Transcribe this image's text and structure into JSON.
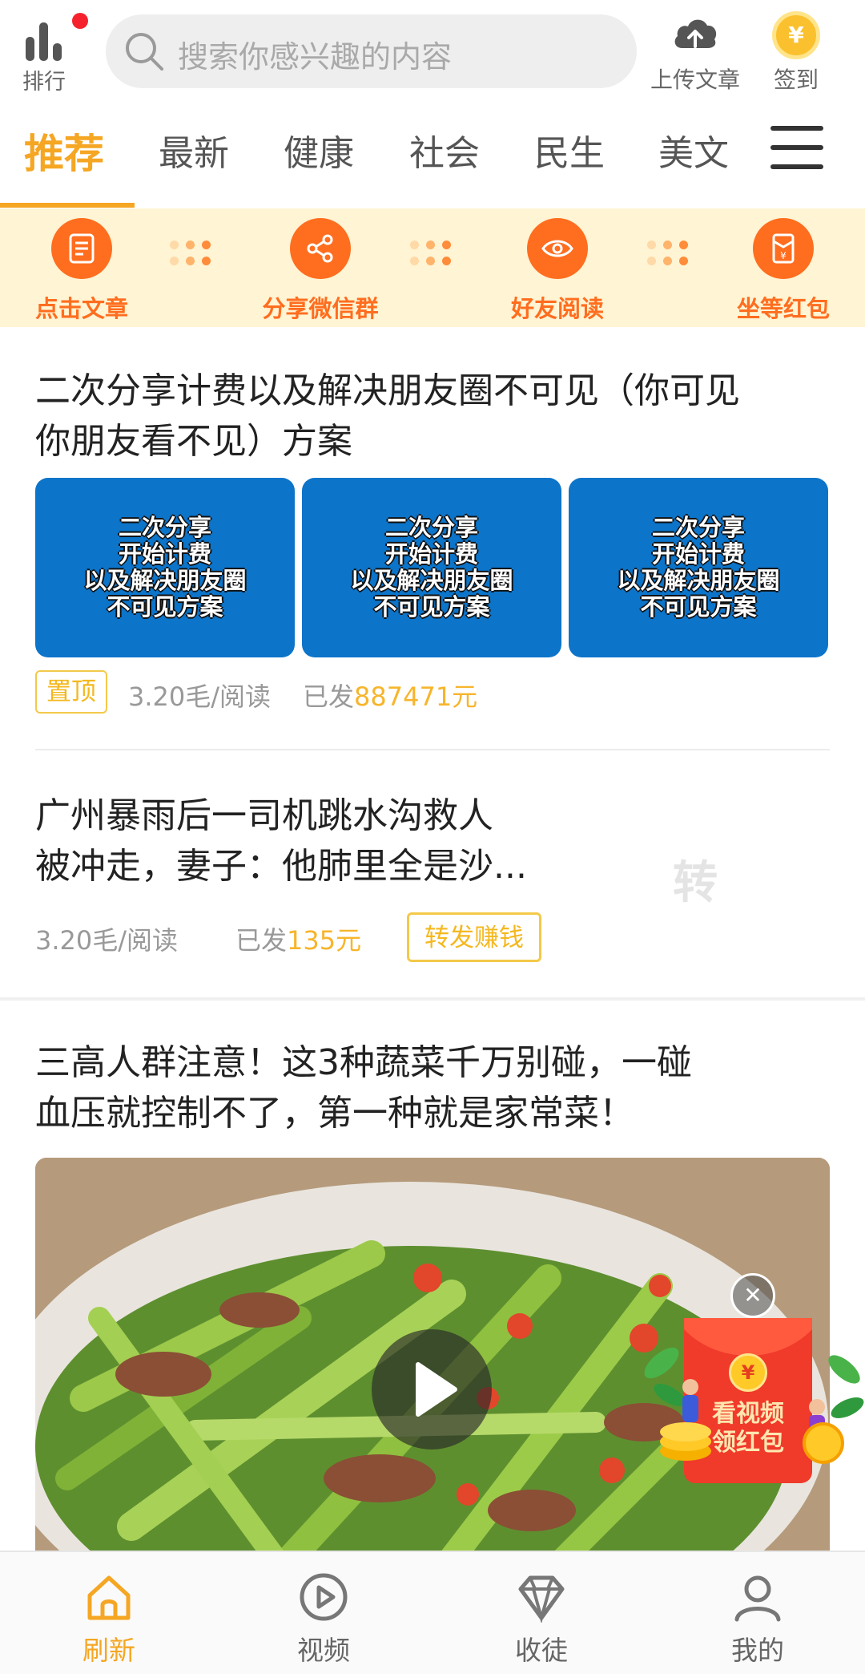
{
  "header": {
    "rank_label": "排行",
    "search_placeholder": "搜索你感兴趣的内容",
    "upload_label": "上传文章",
    "signin_label": "签到",
    "coin_symbol": "¥"
  },
  "tabs": [
    {
      "label": "推荐",
      "active": true
    },
    {
      "label": "最新",
      "active": false
    },
    {
      "label": "健康",
      "active": false
    },
    {
      "label": "社会",
      "active": false
    },
    {
      "label": "民生",
      "active": false
    },
    {
      "label": "美文",
      "active": false
    }
  ],
  "steps": [
    {
      "label": "点击文章",
      "icon": "document-icon"
    },
    {
      "label": "分享微信群",
      "icon": "share-icon"
    },
    {
      "label": "好友阅读",
      "icon": "eye-icon"
    },
    {
      "label": "坐等红包",
      "icon": "red-envelope-icon"
    }
  ],
  "articles": [
    {
      "title_line1": "二次分享计费以及解决朋友圈不可见（你可见",
      "title_line2": "你朋友看不见）方案",
      "thumb_text": [
        "二次分享",
        "开始计费",
        "以及解决朋友圈",
        "不可见方案"
      ],
      "tag": "置顶",
      "rate": "3.20毛/阅读",
      "sent_prefix": "已发",
      "sent_amount": "887471元"
    },
    {
      "title_line1": "广州暴雨后一司机跳水沟救人",
      "title_line2": "被冲走，妻子：他肺里全是沙...",
      "rate": "3.20毛/阅读",
      "sent_prefix": "已发",
      "sent_amount": "135元",
      "action": "转发赚钱",
      "watermark": "转"
    },
    {
      "title_line1": "三高人群注意！这3种蔬菜千万别碰，一碰",
      "title_line2": "血压就控制不了，第一种就是家常菜！"
    }
  ],
  "promo": {
    "line1": "看视频",
    "line2": "领红包",
    "coin_symbol": "¥",
    "close_symbol": "✕"
  },
  "bottom_nav": [
    {
      "label": "刷新",
      "icon": "home-icon",
      "active": true
    },
    {
      "label": "视频",
      "icon": "play-circle-icon",
      "active": false
    },
    {
      "label": "收徒",
      "icon": "diamond-icon",
      "active": false
    },
    {
      "label": "我的",
      "icon": "user-icon",
      "active": false
    }
  ],
  "colors": {
    "accent": "#f5a623",
    "step_orange": "#ff6d1f",
    "steps_background": "#fff4d3",
    "thumb_blue": "#0c74c9",
    "amount_yellow": "#f7b52c",
    "packet_red": "#f03a2a"
  }
}
